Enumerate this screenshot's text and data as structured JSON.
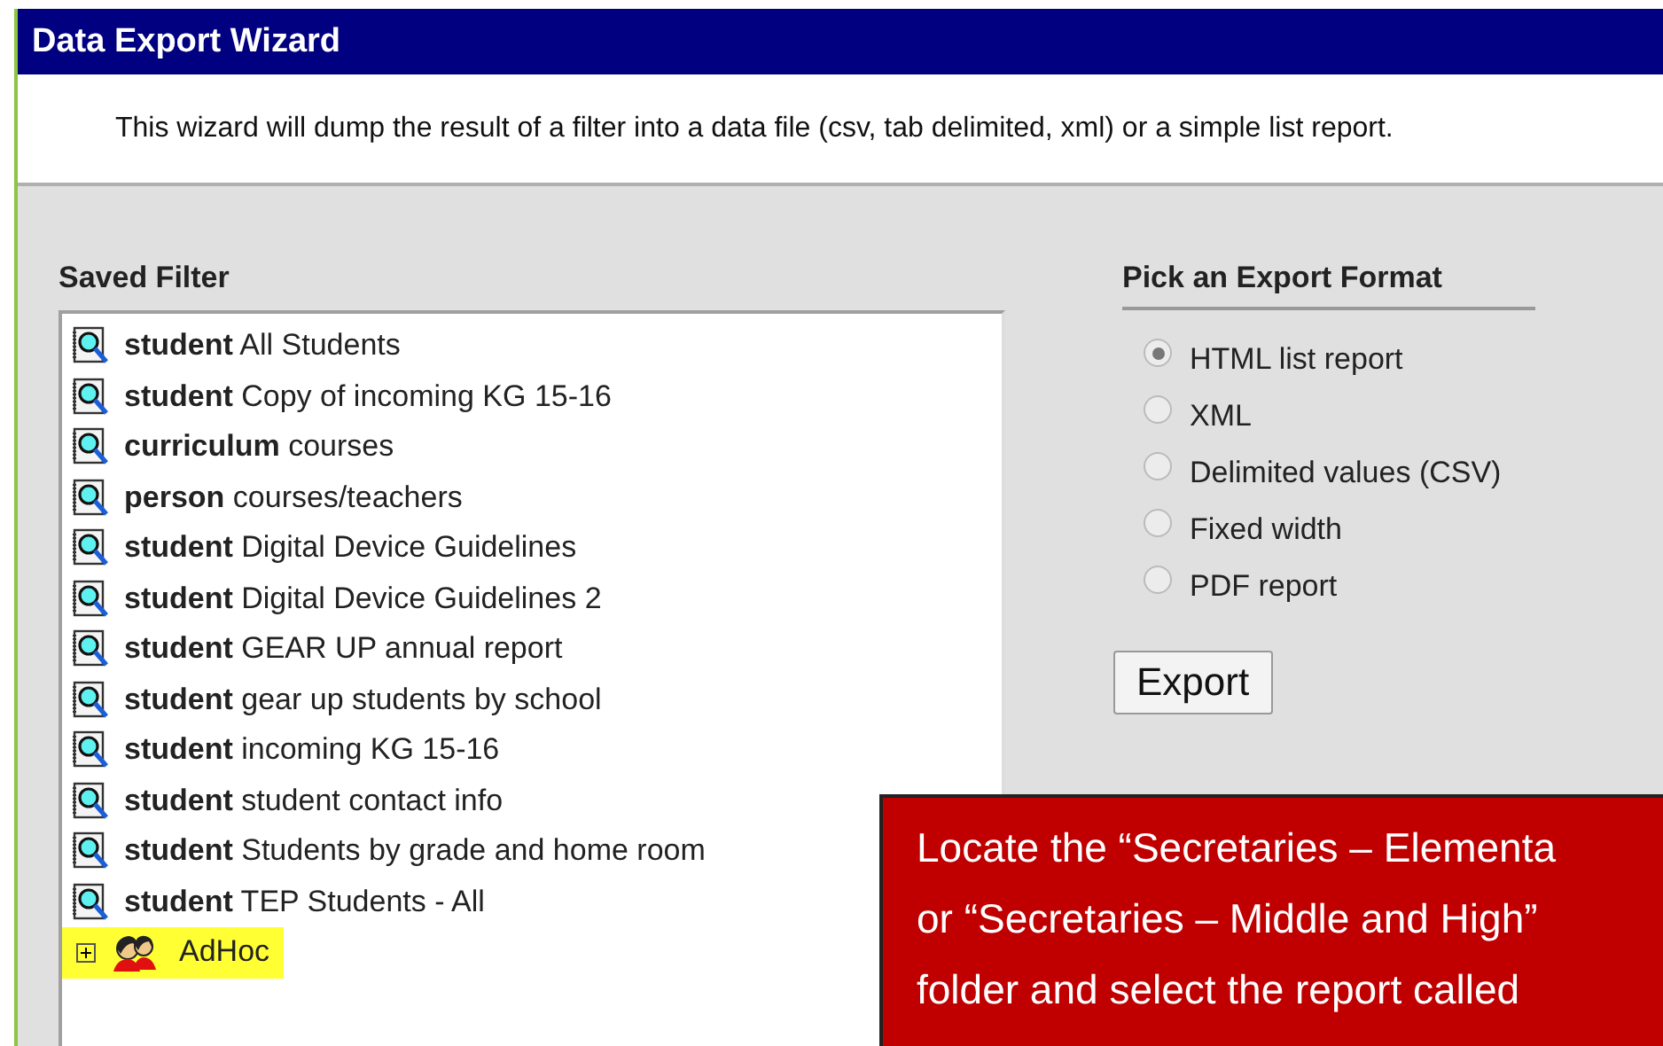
{
  "window": {
    "title": "Data Export Wizard"
  },
  "description": "This wizard will dump the result of a filter into a data file (csv, tab delimited, xml) or a simple list report.",
  "saved_filter": {
    "label": "Saved Filter",
    "items": [
      {
        "type": "student",
        "name": "All Students"
      },
      {
        "type": "student",
        "name": "Copy of incoming KG 15-16"
      },
      {
        "type": "curriculum",
        "name": "courses"
      },
      {
        "type": "person",
        "name": "courses/teachers"
      },
      {
        "type": "student",
        "name": "Digital Device Guidelines"
      },
      {
        "type": "student",
        "name": "Digital Device Guidelines 2"
      },
      {
        "type": "student",
        "name": "GEAR UP annual report"
      },
      {
        "type": "student",
        "name": "gear up students by school"
      },
      {
        "type": "student",
        "name": "incoming KG 15-16"
      },
      {
        "type": "student",
        "name": "student contact info"
      },
      {
        "type": "student",
        "name": "Students by grade and home room"
      },
      {
        "type": "student",
        "name": "TEP Students - All"
      }
    ],
    "folders": [
      {
        "name": "AdHoc",
        "expanded": false,
        "highlighted": true
      }
    ]
  },
  "export_format": {
    "label": "Pick an Export Format",
    "options": [
      {
        "label": "HTML list report",
        "selected": true
      },
      {
        "label": "XML",
        "selected": false
      },
      {
        "label": "Delimited values (CSV)",
        "selected": false
      },
      {
        "label": "Fixed width",
        "selected": false
      },
      {
        "label": "PDF report",
        "selected": false
      }
    ],
    "button": "Export"
  },
  "callout": {
    "lines": [
      "Locate the “Secretaries – Elementa",
      "or “Secretaries – Middle and High”",
      "folder and select the report called"
    ]
  }
}
